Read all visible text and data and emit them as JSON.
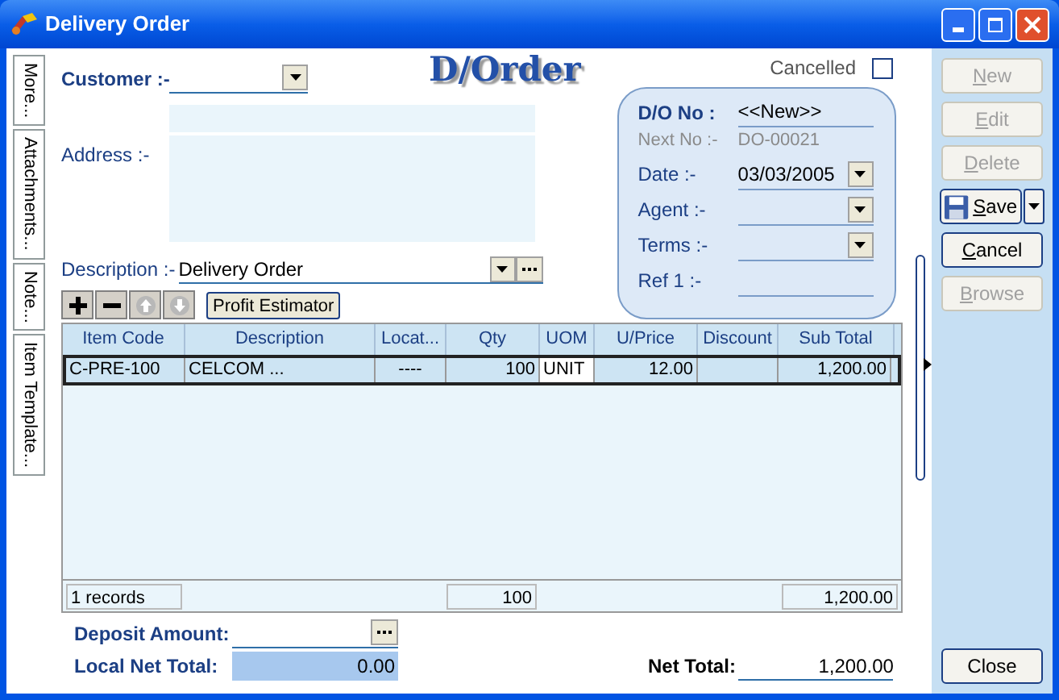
{
  "window": {
    "title": "Delivery Order"
  },
  "side_tabs": [
    {
      "label": "More..."
    },
    {
      "label": "Attachments..."
    },
    {
      "label": "Note..."
    },
    {
      "label": "Item Template..."
    }
  ],
  "customer": {
    "label": "Customer :-"
  },
  "heading": "D/Order",
  "address": {
    "label": "Address :-"
  },
  "cancelled": {
    "label": "Cancelled",
    "checked": false
  },
  "doc_panel": {
    "number_label": "D/O No :",
    "number": "<<New>>",
    "next_label": "Next No :-",
    "next_no": "DO-00021",
    "fields": [
      {
        "label": "Date :-",
        "value": "03/03/2005",
        "kind": "dropdown"
      },
      {
        "label": "Agent :-",
        "kind": "dropdown"
      },
      {
        "label": "Terms :-",
        "kind": "dropdown"
      },
      {
        "label": "Ref 1 :-",
        "kind": "text"
      }
    ]
  },
  "description": {
    "label": "Description :-",
    "value": "Delivery Order"
  },
  "toolbar": [
    {
      "kind": "add",
      "disabled": false
    },
    {
      "kind": "remove",
      "disabled": false
    },
    {
      "kind": "up",
      "disabled": true
    },
    {
      "kind": "down",
      "disabled": true
    }
  ],
  "profit_button": "Profit Estimator",
  "table": {
    "columns": [
      "Item Code",
      "Description",
      "Locat...",
      "Qty",
      "UOM",
      "U/Price",
      "Discount",
      "Sub Total"
    ],
    "rows": [
      {
        "selected": true,
        "cells": [
          "C-PRE-100",
          "CELCOM ...",
          "----",
          "100",
          "UNIT",
          "12.00",
          "",
          "1,200.00"
        ]
      }
    ],
    "footer": {
      "records": "1 records",
      "qty": "100",
      "total": "1,200.00"
    }
  },
  "deposit": {
    "label": "Deposit Amount:"
  },
  "local_net": {
    "label": "Local Net Total:",
    "value": "0.00"
  },
  "net_total": {
    "label": "Net Total:",
    "value": "1,200.00"
  },
  "actions": [
    {
      "label": "New",
      "disabled": true,
      "kind": "plain"
    },
    {
      "label": "Edit",
      "disabled": true,
      "kind": "plain"
    },
    {
      "label": "Delete",
      "disabled": true,
      "kind": "plain"
    },
    {
      "label": "Save",
      "disabled": false,
      "kind": "split"
    },
    {
      "label": "Cancel",
      "disabled": false,
      "kind": "plain"
    },
    {
      "label": "Browse",
      "disabled": true,
      "kind": "plain"
    }
  ],
  "close_button": "Close"
}
